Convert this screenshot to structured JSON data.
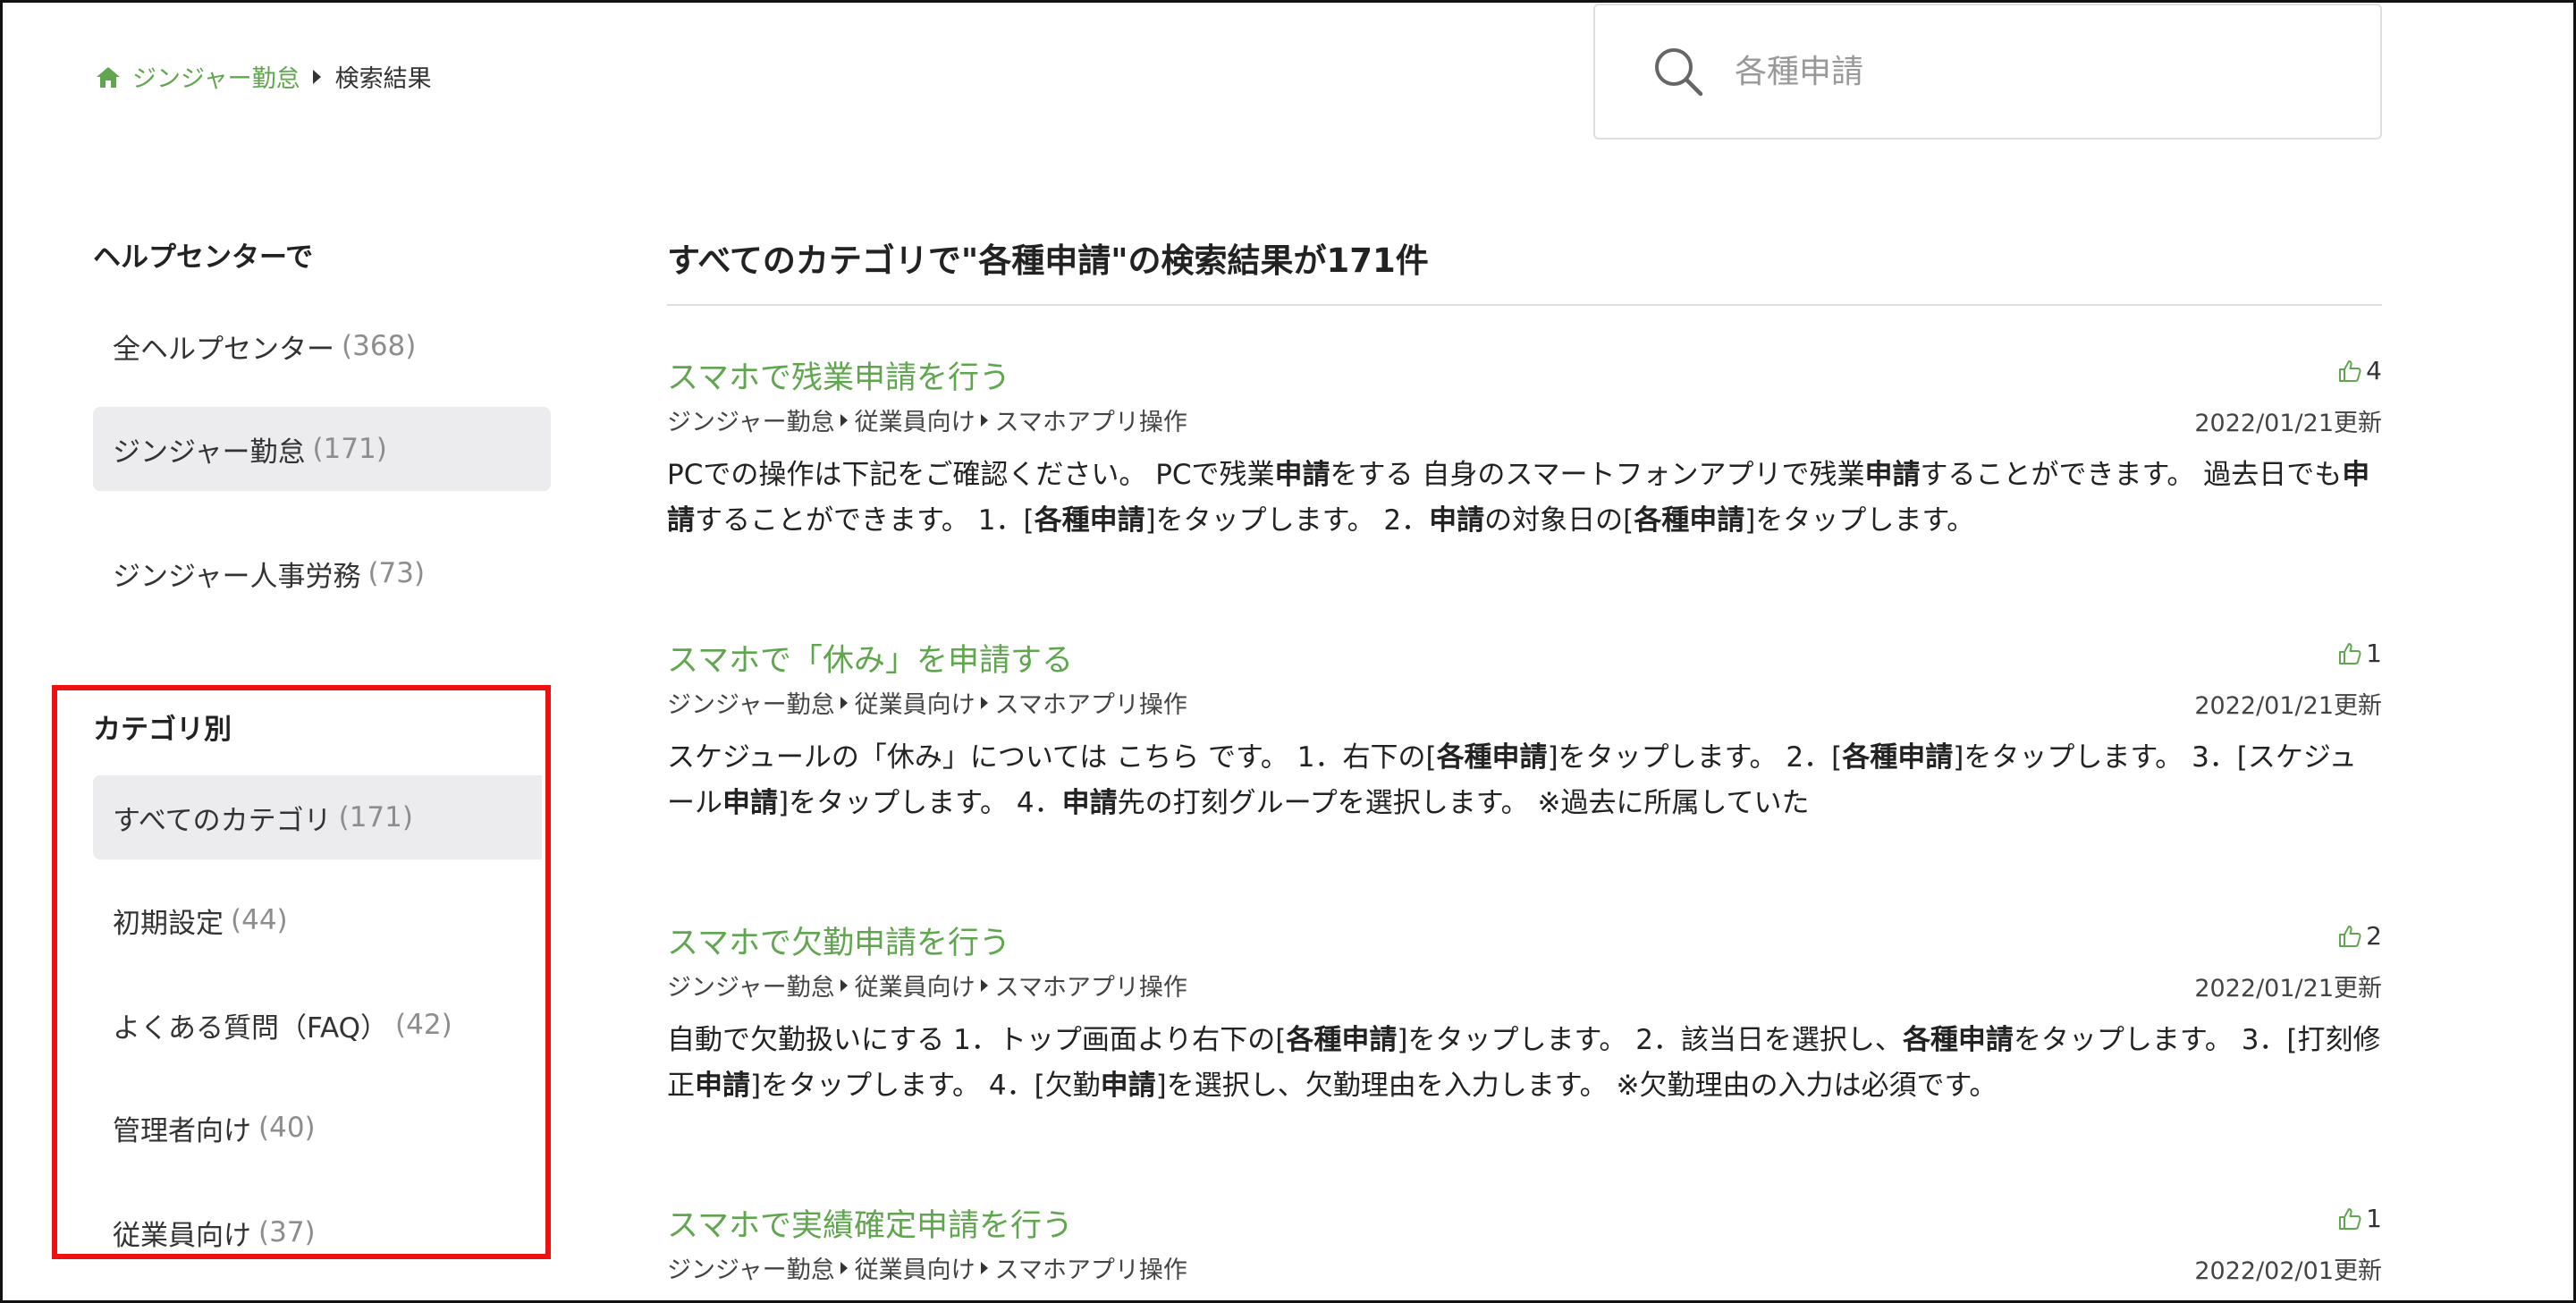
{
  "breadcrumb": {
    "home": "ジンジャー勤怠",
    "current": "検索結果"
  },
  "search": {
    "value": "",
    "placeholder": "各種申請"
  },
  "sidebar": {
    "helpcenter_heading": "ヘルプセンターで",
    "helpcenters": [
      {
        "label": "全ヘルプセンター",
        "count": "(368)",
        "selected": false
      },
      {
        "label": "ジンジャー勤怠",
        "count": "(171)",
        "selected": true
      },
      {
        "label": "ジンジャー人事労務",
        "count": "(73)",
        "selected": false
      }
    ],
    "category_heading": "カテゴリ別",
    "categories": [
      {
        "label": "すべてのカテゴリ",
        "count": "(171)",
        "selected": true
      },
      {
        "label": "初期設定",
        "count": "(44)",
        "selected": false
      },
      {
        "label": "よくある質問（FAQ）",
        "count": "(42)",
        "selected": false
      },
      {
        "label": "管理者向け",
        "count": "(40)",
        "selected": false
      },
      {
        "label": "従業員向け",
        "count": "(37)",
        "selected": false
      }
    ]
  },
  "main": {
    "results_title": "すべてのカテゴリで\"各種申請\"の検索結果が171件",
    "results": [
      {
        "title": "スマホで残業申請を行う",
        "votes": "4",
        "path": [
          "ジンジャー勤怠",
          "従業員向け",
          "スマホアプリ操作"
        ],
        "date": "2022/01/21更新",
        "snippet": [
          {
            "t": "PCでの操作は下記をご確認ください。 PCで残業"
          },
          {
            "t": "申請",
            "b": true
          },
          {
            "t": "をする 自身のスマートフォンアプリで残業"
          },
          {
            "t": "申請",
            "b": true
          },
          {
            "t": "することができます。 過去日でも"
          },
          {
            "t": "申請",
            "b": true
          },
          {
            "t": "することができます。 1．["
          },
          {
            "t": "各種申請",
            "b": true
          },
          {
            "t": "]をタップします。 2．"
          },
          {
            "t": "申請",
            "b": true
          },
          {
            "t": "の対象日の["
          },
          {
            "t": "各種申請",
            "b": true
          },
          {
            "t": "]をタップします。"
          }
        ]
      },
      {
        "title": "スマホで「休み」を申請する",
        "votes": "1",
        "path": [
          "ジンジャー勤怠",
          "従業員向け",
          "スマホアプリ操作"
        ],
        "date": "2022/01/21更新",
        "snippet": [
          {
            "t": "スケジュールの「休み」については こちら です。 1．右下の["
          },
          {
            "t": "各種申請",
            "b": true
          },
          {
            "t": "]をタップします。 2．["
          },
          {
            "t": "各種申請",
            "b": true
          },
          {
            "t": "]をタップします。 3．[スケジュール"
          },
          {
            "t": "申請",
            "b": true
          },
          {
            "t": "]をタップします。 4．"
          },
          {
            "t": "申請",
            "b": true
          },
          {
            "t": "先の打刻グループを選択します。 ※過去に所属していた"
          }
        ]
      },
      {
        "title": "スマホで欠勤申請を行う",
        "votes": "2",
        "path": [
          "ジンジャー勤怠",
          "従業員向け",
          "スマホアプリ操作"
        ],
        "date": "2022/01/21更新",
        "snippet": [
          {
            "t": "自動で欠勤扱いにする 1．トップ画面より右下の["
          },
          {
            "t": "各種申請",
            "b": true
          },
          {
            "t": "]をタップします。 2．該当日を選択し、"
          },
          {
            "t": "各種申請",
            "b": true
          },
          {
            "t": "をタップします。 3．[打刻修正"
          },
          {
            "t": "申請",
            "b": true
          },
          {
            "t": "]をタップします。 4．[欠勤"
          },
          {
            "t": "申請",
            "b": true
          },
          {
            "t": "]を選択し、欠勤理由を入力します。 ※欠勤理由の入力は必須です。"
          }
        ]
      },
      {
        "title": "スマホで実績確定申請を行う",
        "votes": "1",
        "path": [
          "ジンジャー勤怠",
          "従業員向け",
          "スマホアプリ操作"
        ],
        "date": "2022/02/01更新",
        "snippet": []
      }
    ]
  },
  "colors": {
    "accent_green": "#5fa64e",
    "highlight_red": "#ee1111",
    "selected_bg": "#ececee"
  },
  "icons": {
    "home": "home-icon",
    "search": "search-icon",
    "thumbs_up": "thumbs-up-icon"
  }
}
